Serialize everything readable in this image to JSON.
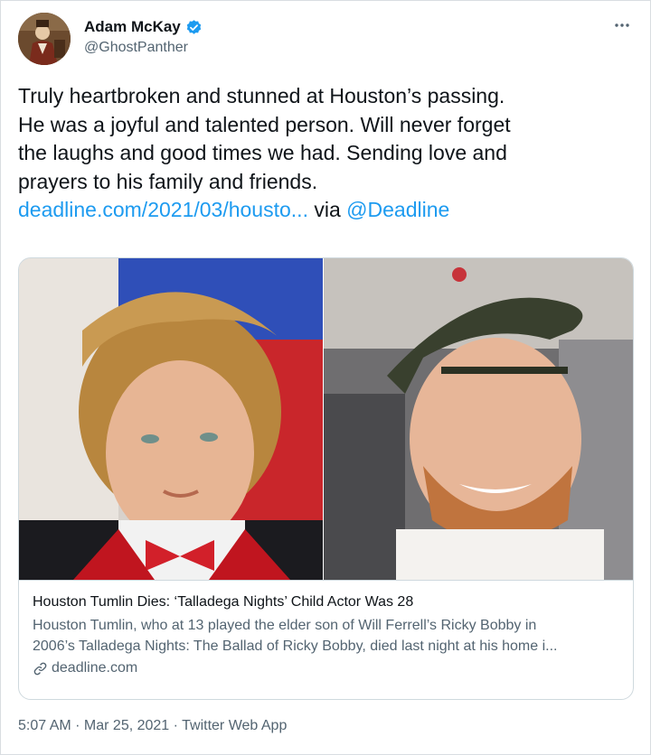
{
  "author": {
    "display_name": "Adam McKay",
    "handle": "@GhostPanther",
    "verified_icon": "verified-badge-icon",
    "badge_color": "#1d9bf0"
  },
  "more_icon": "more-dots-icon",
  "tweet": {
    "lines": [
      "Truly heartbroken and stunned at Houston’s passing.",
      "He was a joyful and talented person. Will never forget",
      "the laughs and good times we had. Sending love and",
      "prayers to his family and friends."
    ],
    "link_text": "deadline.com/2021/03/housto...",
    "via_text": " via ",
    "mention": "@Deadline"
  },
  "card": {
    "title": "Houston Tumlin Dies: ‘Talladega Nights’ Child Actor Was 28",
    "description_lines": [
      "Houston Tumlin, who at 13 played the elder son of Will Ferrell’s Ricky Bobby in",
      "2006’s Talladega Nights: The Ballad of Ricky Bobby, died last night at his home i..."
    ],
    "domain": "deadline.com",
    "domain_icon": "link-icon"
  },
  "meta": {
    "time": "5:07 AM",
    "separator": " · ",
    "date": "Mar 25, 2021",
    "source": "Twitter Web App"
  },
  "colors": {
    "link": "#1d9bf0",
    "text": "#0f1419",
    "secondary": "#536471"
  }
}
